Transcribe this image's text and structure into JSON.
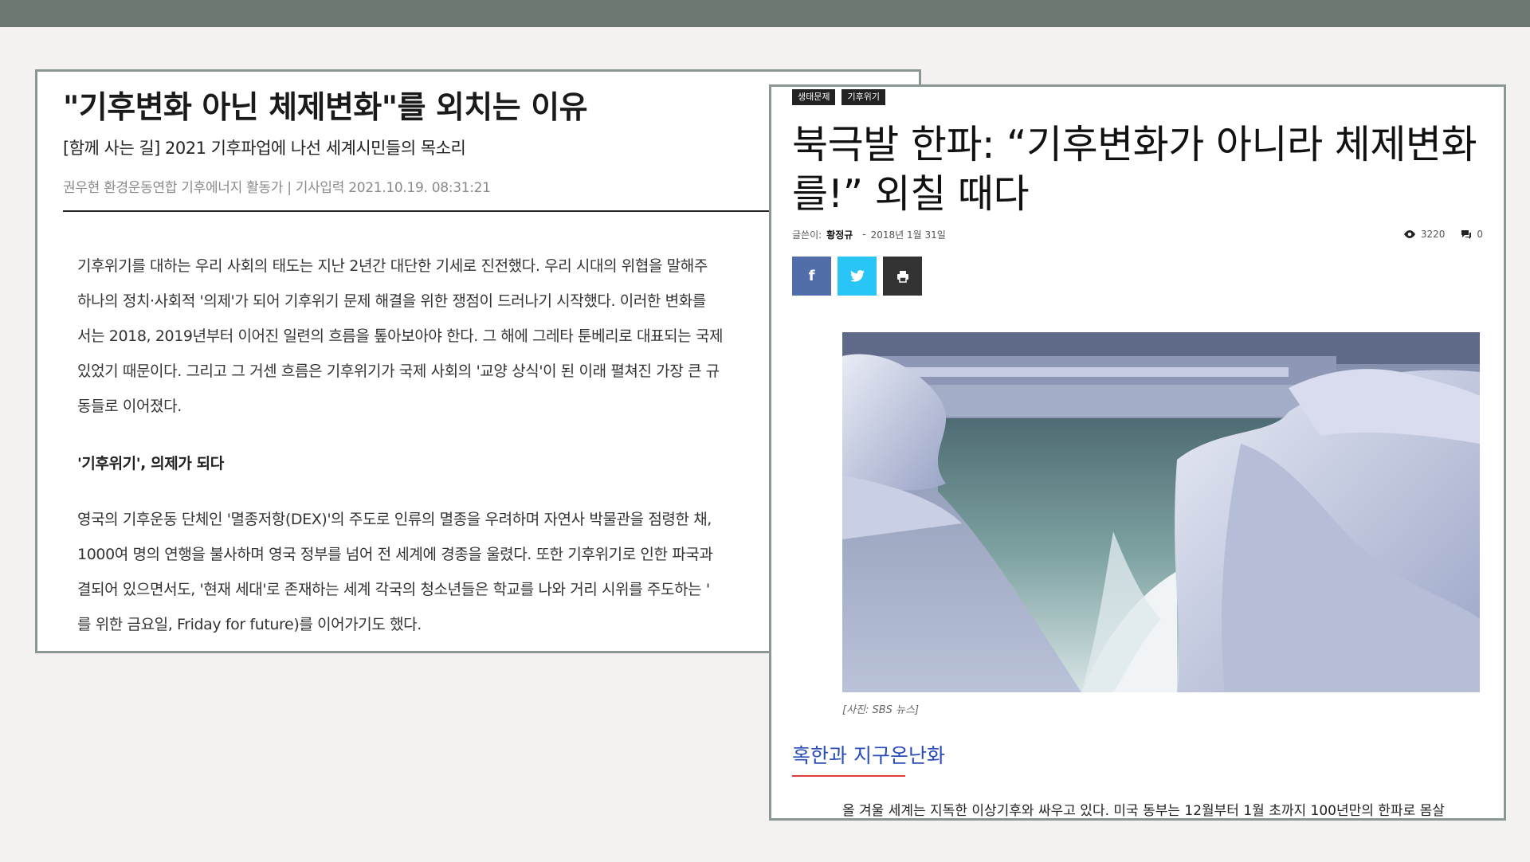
{
  "left_article": {
    "headline": "\"기후변화 아닌 체제변화\"를 외치는 이유",
    "subhead": "[함께 사는 길] 2021 기후파업에 나선 세계시민들의 목소리",
    "byline": "권우현 환경운동연합 기후에너지 활동가 | 기사입력 2021.10.19. 08:31:21",
    "paragraph1": [
      "기후위기를 대하는 우리 사회의 태도는 지난 2년간 대단한 기세로 진전했다. 우리 시대의 위협을 말해주",
      "하나의 정치·사회적 '의제'가 되어 기후위기 문제 해결을 위한 쟁점이 드러나기 시작했다. 이러한 변화를",
      "서는 2018, 2019년부터 이어진 일련의 흐름을 톺아보아야 한다. 그 해에 그레타 툰베리로 대표되는 국제",
      "있었기 때문이다. 그리고 그 거센 흐름은 기후위기가 국제 사회의 '교양 상식'이 된 이래 펼쳐진 가장 큰 규",
      "동들로 이어졌다."
    ],
    "section_heading": "'기후위기', 의제가 되다",
    "paragraph2": [
      "영국의 기후운동 단체인 '멸종저항(DEX)'의  주도로 인류의 멸종을 우려하며 자연사 박물관을 점령한 채,",
      "1000여 명의 연행을 불사하며 영국 정부를 넘어 전 세계에 경종을 울렸다. 또한 기후위기로 인한 파국과",
      "결되어 있으면서도, '현재 세대'로 존재하는 세계 각국의 청소년들은 학교를 나와 거리 시위를 주도하는 '",
      "를 위한 금요일, Friday for future)를 이어가기도 했다."
    ]
  },
  "right_article": {
    "tags": [
      "생태문제",
      "기후위기"
    ],
    "title": "북극발 한파: “기후변화가 아니라 체제변화를!” 외칠 때다",
    "author_label": "글쓴이:",
    "author": "황정규",
    "date_sep": "-",
    "date": "2018년 1월 31일",
    "views": "3220",
    "comments": "0",
    "share_icons": [
      "facebook-icon",
      "twitter-icon",
      "print-icon"
    ],
    "caption": "[사진: SBS 뉴스]",
    "section_title": "혹한과 지구온난화",
    "body_line": "올 겨울 세계는 지독한 이상기후와 싸우고 있다. 미국 동부는 12월부터 1월 초까지 100년만의 한파로 몸살"
  },
  "colors": {
    "topbar": "#6b7770",
    "card_border": "#8b9794",
    "facebook": "#516eab",
    "twitter": "#29c5f6",
    "print": "#333333",
    "section_title": "#2a4db8",
    "section_underline": "#e03a3a"
  }
}
